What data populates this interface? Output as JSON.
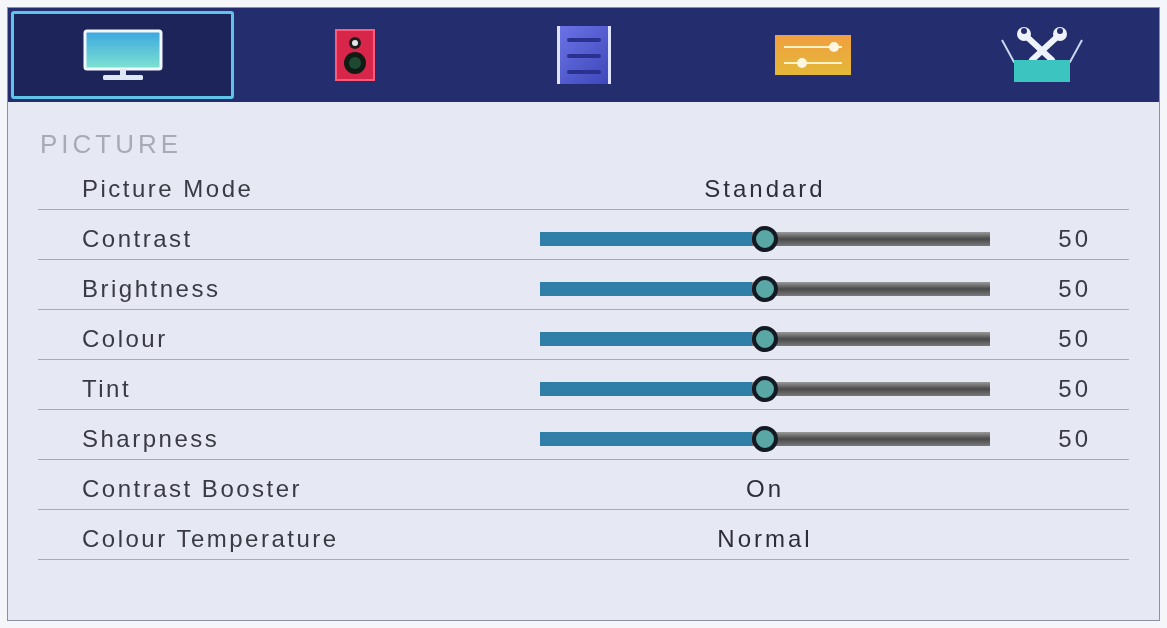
{
  "tabs": [
    {
      "selected": true
    },
    {
      "selected": false
    },
    {
      "selected": false
    },
    {
      "selected": false
    },
    {
      "selected": false
    }
  ],
  "section_title": "PICTURE",
  "settings": [
    {
      "kind": "value",
      "label": "Picture Mode",
      "value": "Standard"
    },
    {
      "kind": "slider",
      "label": "Contrast",
      "level": 0.5,
      "reading": "50"
    },
    {
      "kind": "slider",
      "label": "Brightness",
      "level": 0.5,
      "reading": "50"
    },
    {
      "kind": "slider",
      "label": "Colour",
      "level": 0.5,
      "reading": "50"
    },
    {
      "kind": "slider",
      "label": "Tint",
      "level": 0.5,
      "reading": "50"
    },
    {
      "kind": "slider",
      "label": "Sharpness",
      "level": 0.5,
      "reading": "50"
    },
    {
      "kind": "value",
      "label": "Contrast Booster",
      "value": "On"
    },
    {
      "kind": "value",
      "label": "Colour Temperature",
      "value": "Normal"
    }
  ]
}
